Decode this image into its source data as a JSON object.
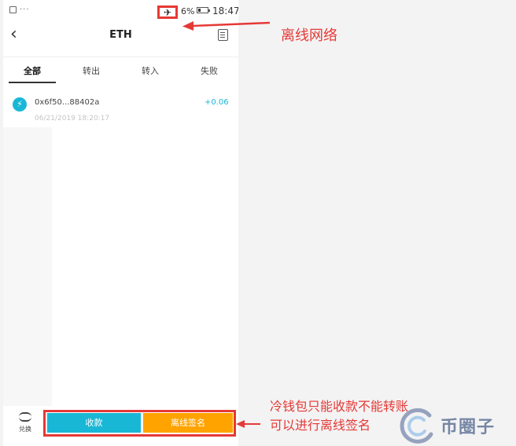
{
  "status_bar": {
    "dots": "···",
    "airplane_icon": "airplane-mode-icon",
    "battery": "6%",
    "time": "18:47"
  },
  "nav": {
    "title": "ETH",
    "back_icon": "chevron-left-icon",
    "detail_icon": "document-icon"
  },
  "tabs": [
    {
      "label": "全部",
      "active": true
    },
    {
      "label": "转出",
      "active": false
    },
    {
      "label": "转入",
      "active": false
    },
    {
      "label": "失败",
      "active": false
    }
  ],
  "transactions": [
    {
      "address": "0x6f50...88402a",
      "amount": "+0.06",
      "time": "06/21/2019 18:20:17",
      "icon": "lightning-icon"
    }
  ],
  "bottom": {
    "exchange_label": "兑换",
    "receive_label": "收款",
    "offline_sign_label": "离线签名"
  },
  "annotations": {
    "top_note": "离线网络",
    "bottom_note_line1": "冷钱包只能收款不能转账",
    "bottom_note_line2": "可以进行离线签名"
  },
  "watermark": {
    "text": "币圈子"
  },
  "colors": {
    "annotation_red": "#e53935",
    "accent_cyan": "#19b7d6",
    "accent_orange": "#ffa300"
  }
}
